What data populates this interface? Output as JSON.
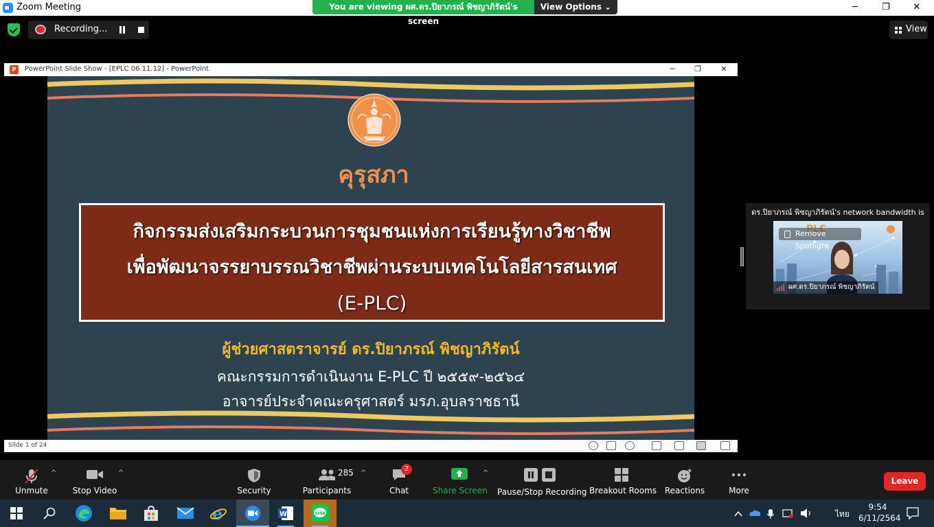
{
  "window": {
    "title": "Zoom Meeting",
    "minimize_glyph": "─",
    "maximize_glyph": "❐",
    "close_glyph": "✕"
  },
  "share_banner": {
    "viewing_text": "You are viewing ผศ.ดร.ปิยาภรณ์ พิชญาภิรัตน์'s screen",
    "view_options_label": "View Options ⌄"
  },
  "recording": {
    "label": "Recording..."
  },
  "view_button": {
    "label": "View"
  },
  "powerpoint": {
    "title": "PowerPoint Slide Show - [EPLC 06.11.12] - PowerPoint",
    "icon_letter": "P",
    "status": "Slide 1 of 24"
  },
  "slide": {
    "org_name": "คุรุสภา",
    "title_line_1": "กิจกรรมส่งเสริมกระบวนการชุมชนแห่งการเรียนรู้ทางวิชาชีพ",
    "title_line_2": "เพื่อพัฒนาจรรยาบรรณวิชาชีพผ่านระบบเทคโนโลยีสารสนเทศ",
    "title_line_3": "(E-PLC)",
    "presenter": "ผู้ช่วยศาสตราจารย์ ดร.ปิยาภรณ์  พิชญาภิรัตน์",
    "info_1": "คณะกรรมการดำเนินงาน E-PLC ปี ๒๕๕๙-๒๕๖๔",
    "info_2": "อาจารย์ประจำคณะครุศาสตร์ มรภ.อุบลราชธานี"
  },
  "participant_video": {
    "bandwidth_text": "ดร.ปิยาภรณ์ พิชญาภิรัตน์'s network bandwidth is",
    "remove_spotlight": "Remove Spotlight",
    "name": "ผศ.ดร.ปิยาภรณ์ พิชญาภิรัตน์",
    "bg_logo_text": "PLC"
  },
  "controls": {
    "unmute": "Unmute",
    "stop_video": "Stop Video",
    "security": "Security",
    "participants": "Participants",
    "participants_count": "285",
    "chat": "Chat",
    "chat_badge": "2",
    "share_screen": "Share Screen",
    "pause_stop_recording": "Pause/Stop Recording",
    "breakout_rooms": "Breakout Rooms",
    "reactions": "Reactions",
    "more": "More",
    "leave": "Leave",
    "caret": "^"
  },
  "taskbar": {
    "language": "ไทย",
    "time": "9:54",
    "date": "6/11/2564"
  },
  "colors": {
    "share_green": "#22b14c",
    "leave_red": "#e02828",
    "slide_bg": "#2e4350",
    "title_box": "#7d2a17",
    "seal_orange": "#f2924a",
    "stripe_yellow": "#f0c860",
    "stripe_coral": "#e97a5a",
    "presenter_yellow": "#f5b92a"
  }
}
